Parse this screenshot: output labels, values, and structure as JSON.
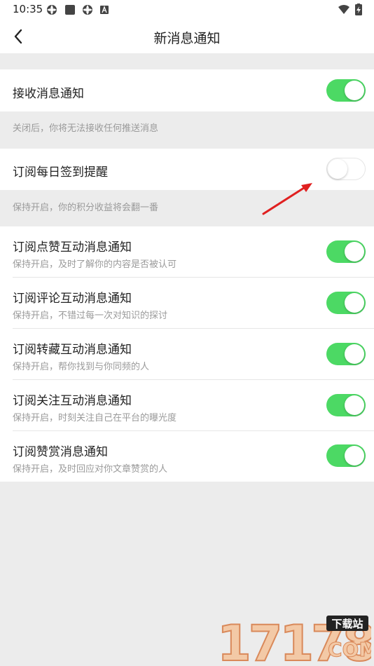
{
  "status_bar": {
    "time": "10:35",
    "icons": [
      "settings-gear-icon",
      "square-app-icon",
      "settings-gear-icon",
      "a-badge-icon"
    ],
    "right_icons": [
      "wifi-icon",
      "battery-charging-icon"
    ]
  },
  "header": {
    "title": "新消息通知",
    "back_icon": "chevron-left-icon"
  },
  "colors": {
    "toggle_on": "#4cd964",
    "toggle_off_border": "#e5e5e5",
    "background": "#ececec",
    "arrow": "#e02020"
  },
  "sections": {
    "receive": {
      "label": "接收消息通知",
      "enabled": true,
      "caption": "关闭后，你将无法接收任何推送消息"
    },
    "checkin": {
      "label": "订阅每日签到提醒",
      "enabled": false,
      "caption": "保持开启，你的积分收益将会翻一番"
    },
    "items": [
      {
        "label": "订阅点赞互动消息通知",
        "sub": "保持开启，及时了解你的内容是否被认可",
        "enabled": true
      },
      {
        "label": "订阅评论互动消息通知",
        "sub": "保持开启，不错过每一次对知识的探讨",
        "enabled": true
      },
      {
        "label": "订阅转藏互动消息通知",
        "sub": "保持开启，帮你找到与你同频的人",
        "enabled": true
      },
      {
        "label": "订阅关注互动消息通知",
        "sub": "保持开启，时刻关注自己在平台的曝光度",
        "enabled": true
      },
      {
        "label": "订阅赞赏消息通知",
        "sub": "保持开启，及时回应对你文章赞赏的人",
        "enabled": true
      }
    ]
  },
  "watermark": {
    "number": "17178",
    "badge": "下载站",
    "domain": "COM"
  }
}
